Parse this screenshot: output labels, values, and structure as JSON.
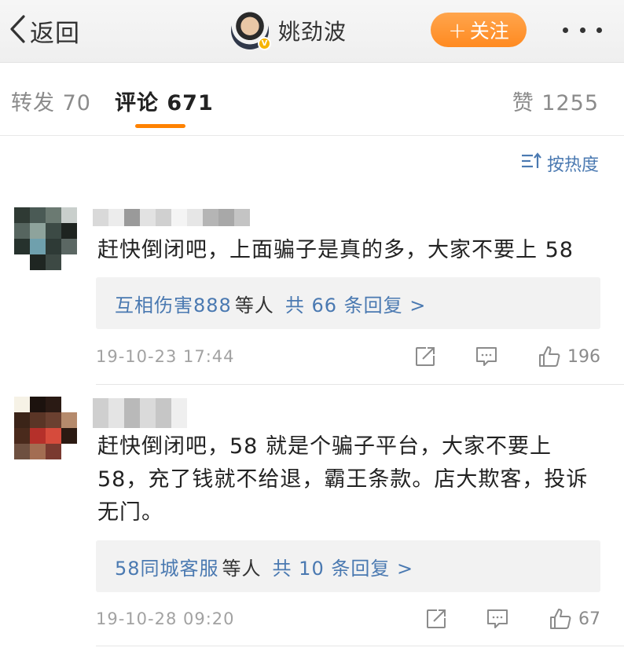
{
  "nav": {
    "back_label": "返回",
    "user_name": "姚劲波",
    "follow_label": "关注"
  },
  "tabs": {
    "reposts": "转发 70",
    "comments": "评论 671",
    "likes": "赞 1255"
  },
  "sort": {
    "label": "按热度"
  },
  "comments": [
    {
      "text": "赶快倒闭吧，上面骗子是真的多，大家不要上 58",
      "reply_preview_user": "互相伤害888",
      "reply_preview_mid": "等人",
      "reply_count_text": "共 66 条回复 >",
      "timestamp": "19-10-23 17:44",
      "likes": "196"
    },
    {
      "text": "赶快倒闭吧，58 就是个骗子平台，大家不要上 58，充了钱就不给退，霸王条款。店大欺客，投诉无门。",
      "reply_preview_user": "58同城客服",
      "reply_preview_mid": "等人",
      "reply_count_text": "共 10 条回复 >",
      "timestamp": "19-10-28 09:20",
      "likes": "67"
    }
  ],
  "colors": {
    "accent_orange": "#ff8200",
    "link_blue": "#4a79b1",
    "muted_gray": "#a2a2a2"
  },
  "icons": [
    "chevron-left-icon",
    "verified-badge-icon",
    "plus-icon",
    "more-icon",
    "sort-icon",
    "repost-icon",
    "comment-icon",
    "thumbs-up-icon"
  ]
}
